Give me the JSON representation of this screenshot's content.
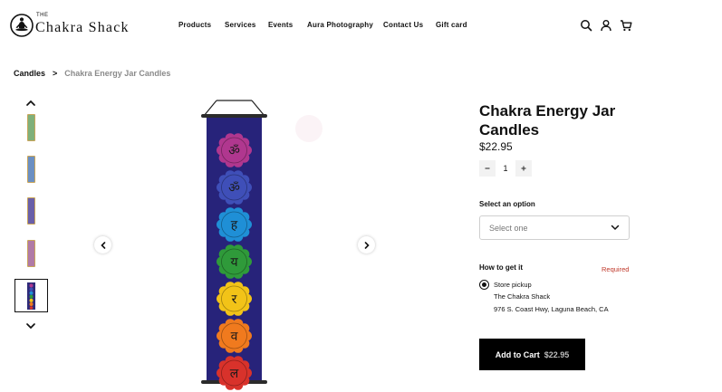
{
  "brand": {
    "the": "THE",
    "name": "Chakra Shack"
  },
  "nav": [
    "Products",
    "Services",
    "Events",
    "Aura Photography",
    "Contact Us",
    "Gift card"
  ],
  "header_icons": [
    "search-icon",
    "account-icon",
    "cart-icon"
  ],
  "breadcrumb": {
    "parent": "Candles",
    "separator": ">",
    "current": "Chakra Energy Jar Candles"
  },
  "gallery": {
    "thumbnails": [
      {
        "color": "#7fb07a",
        "accent": "#c9a55a"
      },
      {
        "color": "#6b8fc2",
        "accent": "#c9a55a"
      },
      {
        "color": "#6a5fa8",
        "accent": "#c9a55a"
      },
      {
        "color": "#b07aa6",
        "accent": "#c9a55a"
      },
      {
        "color": "#2e2b7a",
        "accent": "#d63a2a",
        "active": true
      }
    ],
    "chakra_colors": [
      "#b0378f",
      "#3f4fb8",
      "#1f8fd6",
      "#2f9a3a",
      "#f2c318",
      "#f07a1e",
      "#d8322b"
    ],
    "chakra_glyphs": [
      "ॐ",
      "ॐ",
      "ह",
      "य",
      "र",
      "व",
      "ल"
    ],
    "banner_color": "#27237a"
  },
  "product": {
    "title": "Chakra Energy Jar Candles",
    "price": "$22.95",
    "quantity": "1",
    "option_label": "Select an option",
    "option_placeholder": "Select one",
    "howto_label": "How to get it",
    "required_label": "Required",
    "pickup_label": "Store pickup",
    "store_name": "The Chakra Shack",
    "store_address": "976 S. Coast Hwy, Laguna Beach, CA",
    "cart_label": "Add to Cart",
    "cart_price": "$22.95"
  }
}
